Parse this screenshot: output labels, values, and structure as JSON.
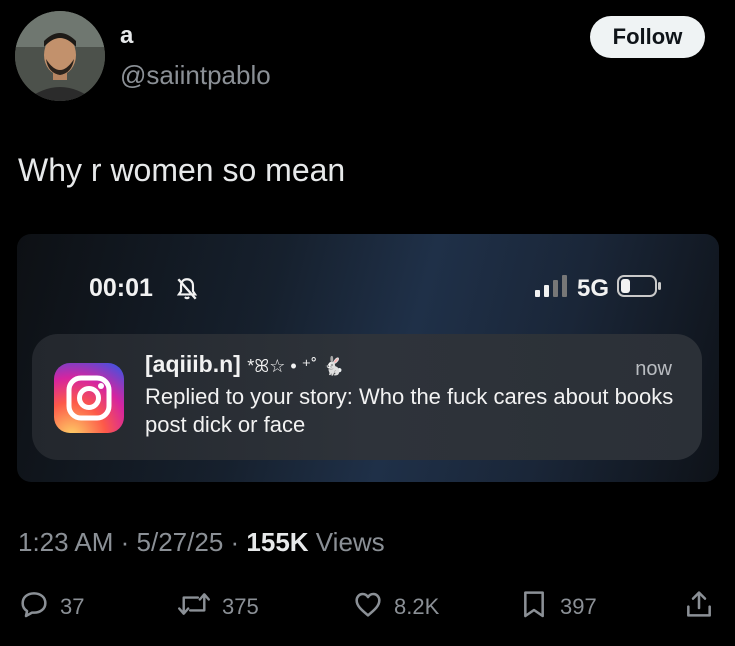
{
  "author": {
    "display_name": "a",
    "handle": "@saiintpablo",
    "avatar_icon": "user-avatar"
  },
  "follow_label": "Follow",
  "tweet_text": "Why r women so mean",
  "screenshot": {
    "status_bar": {
      "time": "00:01",
      "network": "5G",
      "icons": [
        "bell-slash-icon",
        "signal-icon",
        "battery-icon"
      ]
    },
    "notification": {
      "app_icon": "instagram-icon",
      "sender": "[aqiiib.n]",
      "sender_decoration": "*ꕤ☆ • ⁺˚ 🐇",
      "time": "now",
      "body": "Replied to your story: Who the fuck cares about books post dick or face"
    }
  },
  "meta": {
    "time": "1:23 AM",
    "date": "5/27/25",
    "views_count": "155K",
    "views_label": "Views"
  },
  "actions": {
    "replies": "37",
    "reposts": "375",
    "likes": "8.2K",
    "bookmarks": "397"
  },
  "colors": {
    "background": "#000000",
    "secondary_text": "#8b9096",
    "follow_button_bg": "#eff3f4"
  }
}
